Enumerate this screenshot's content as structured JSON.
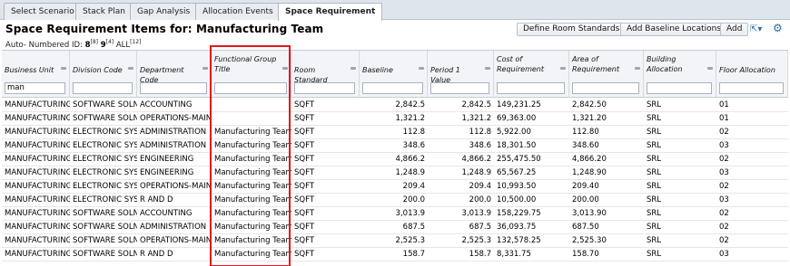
{
  "tabs": [
    {
      "label": "Select Scenario"
    },
    {
      "label": "Stack Plan"
    },
    {
      "label": "Gap Analysis"
    },
    {
      "label": "Allocation Events"
    },
    {
      "label": "Space Requirement"
    }
  ],
  "header": {
    "title": "Space Requirement Items for: Manufacturing Team",
    "buttons": {
      "define_room_standards": "Define Room Standards",
      "add_baseline_locations": "Add Baseline Locations",
      "add": "Add"
    },
    "export_glyph": "⇱▾",
    "gear_glyph": "⚙"
  },
  "auto_number": {
    "label": "Auto- Numbered ID:",
    "a_val": "8",
    "a_sup": "[8]",
    "b_val": "9",
    "b_sup": "[4]",
    "c_val": "ALL",
    "c_sup": "[12]"
  },
  "table": {
    "columns": [
      {
        "line1": "",
        "line2": "Business Unit",
        "filter": "man"
      },
      {
        "line1": "",
        "line2": "Division Code",
        "filter": ""
      },
      {
        "line1": "",
        "line2": "Department Code",
        "filter": ""
      },
      {
        "line1": "Functional Group",
        "line2": "Title",
        "filter": ""
      },
      {
        "line1": "",
        "line2": "Room Standard",
        "filter": ""
      },
      {
        "line1": "",
        "line2": "Baseline",
        "filter": ""
      },
      {
        "line1": "",
        "line2": "Period 1 Value",
        "filter": ""
      },
      {
        "line1": "Cost of",
        "line2": "Requirement",
        "filter": ""
      },
      {
        "line1": "Area of",
        "line2": "Requirement",
        "filter": ""
      },
      {
        "line1": "Building",
        "line2": "Allocation",
        "filter": ""
      },
      {
        "line1": "",
        "line2": "Floor Allocation",
        "filter": ""
      }
    ],
    "rows": [
      {
        "bu": "MANUFACTURING",
        "div": "SOFTWARE SOLN.",
        "dept": "ACCOUNTING",
        "fg": "",
        "rs": "SQFT",
        "base": "2,842.5",
        "p1": "2,842.5",
        "cost": "149,231.25",
        "area": "2,842.50",
        "bld": "SRL",
        "flr": "01"
      },
      {
        "bu": "MANUFACTURING",
        "div": "SOFTWARE SOLN.",
        "dept": "OPERATIONS-MAINT",
        "fg": "",
        "rs": "SQFT",
        "base": "1,321.2",
        "p1": "1,321.2",
        "cost": "69,363.00",
        "area": "1,321.20",
        "bld": "SRL",
        "flr": "01"
      },
      {
        "bu": "MANUFACTURING",
        "div": "ELECTRONIC SYS.",
        "dept": "ADMINISTRATION",
        "fg": "Manufacturing Team",
        "rs": "SQFT",
        "base": "112.8",
        "p1": "112.8",
        "cost": "5,922.00",
        "area": "112.80",
        "bld": "SRL",
        "flr": "02"
      },
      {
        "bu": "MANUFACTURING",
        "div": "ELECTRONIC SYS.",
        "dept": "ADMINISTRATION",
        "fg": "Manufacturing Team",
        "rs": "SQFT",
        "base": "348.6",
        "p1": "348.6",
        "cost": "18,301.50",
        "area": "348.60",
        "bld": "SRL",
        "flr": "03"
      },
      {
        "bu": "MANUFACTURING",
        "div": "ELECTRONIC SYS.",
        "dept": "ENGINEERING",
        "fg": "Manufacturing Team",
        "rs": "SQFT",
        "base": "4,866.2",
        "p1": "4,866.2",
        "cost": "255,475.50",
        "area": "4,866.20",
        "bld": "SRL",
        "flr": "02"
      },
      {
        "bu": "MANUFACTURING",
        "div": "ELECTRONIC SYS.",
        "dept": "ENGINEERING",
        "fg": "Manufacturing Team",
        "rs": "SQFT",
        "base": "1,248.9",
        "p1": "1,248.9",
        "cost": "65,567.25",
        "area": "1,248.90",
        "bld": "SRL",
        "flr": "03"
      },
      {
        "bu": "MANUFACTURING",
        "div": "ELECTRONIC SYS.",
        "dept": "OPERATIONS-MAINT",
        "fg": "Manufacturing Team",
        "rs": "SQFT",
        "base": "209.4",
        "p1": "209.4",
        "cost": "10,993.50",
        "area": "209.40",
        "bld": "SRL",
        "flr": "02"
      },
      {
        "bu": "MANUFACTURING",
        "div": "ELECTRONIC SYS.",
        "dept": "R AND D",
        "fg": "Manufacturing Team",
        "rs": "SQFT",
        "base": "200.0",
        "p1": "200.0",
        "cost": "10,500.00",
        "area": "200.00",
        "bld": "SRL",
        "flr": "03"
      },
      {
        "bu": "MANUFACTURING",
        "div": "SOFTWARE SOLN.",
        "dept": "ACCOUNTING",
        "fg": "Manufacturing Team",
        "rs": "SQFT",
        "base": "3,013.9",
        "p1": "3,013.9",
        "cost": "158,229.75",
        "area": "3,013.90",
        "bld": "SRL",
        "flr": "02"
      },
      {
        "bu": "MANUFACTURING",
        "div": "SOFTWARE SOLN.",
        "dept": "ADMINISTRATION",
        "fg": "Manufacturing Team",
        "rs": "SQFT",
        "base": "687.5",
        "p1": "687.5",
        "cost": "36,093.75",
        "area": "687.50",
        "bld": "SRL",
        "flr": "02"
      },
      {
        "bu": "MANUFACTURING",
        "div": "SOFTWARE SOLN.",
        "dept": "OPERATIONS-MAINT",
        "fg": "Manufacturing Team",
        "rs": "SQFT",
        "base": "2,525.3",
        "p1": "2,525.3",
        "cost": "132,578.25",
        "area": "2,525.30",
        "bld": "SRL",
        "flr": "02"
      },
      {
        "bu": "MANUFACTURING",
        "div": "SOFTWARE SOLN.",
        "dept": "R AND D",
        "fg": "Manufacturing Team",
        "rs": "SQFT",
        "base": "158.7",
        "p1": "158.7",
        "cost": "8,331.75",
        "area": "158.70",
        "bld": "SRL",
        "flr": "03"
      }
    ]
  },
  "colors": {
    "highlight_border": "#e2161b",
    "icon_blue": "#2e6da8",
    "tabbar_bg": "#dfe5ec"
  }
}
